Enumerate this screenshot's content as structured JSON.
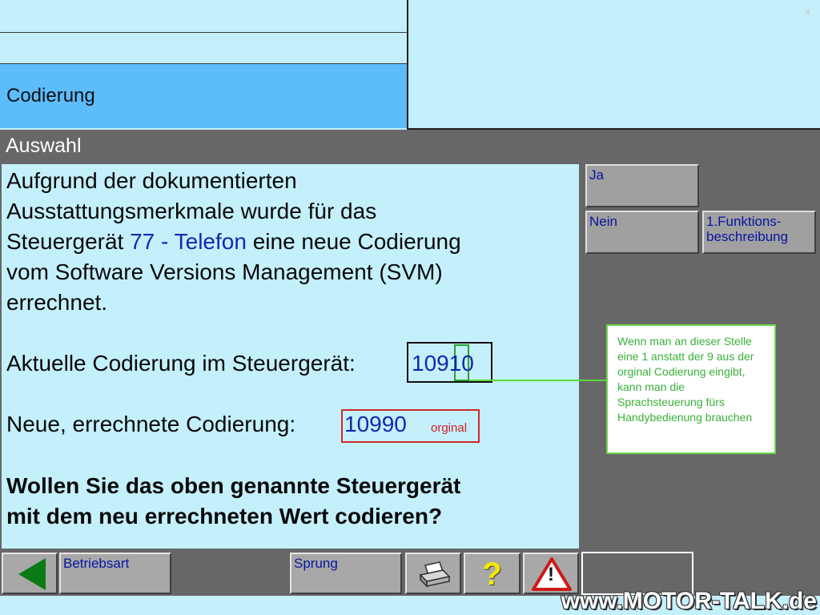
{
  "header": {
    "selected_item": "Codierung",
    "close_glyph": "x"
  },
  "section_title": "Auswahl",
  "message": {
    "line1": "Aufgrund der dokumentierten",
    "line2": "Ausstattungsmerkmale wurde für das",
    "line3_pre": "Steuergerät ",
    "line3_device": "77 - Telefon",
    "line3_post": " eine neue Codierung",
    "line4": "vom Software Versions Management (SVM)",
    "line5": "errechnet.",
    "current_label": "Aktuelle Codierung im Steuergerät:",
    "current_value": "10910",
    "new_label": "Neue, errechnete Codierung:",
    "new_value": "10990",
    "original_note": "orginal",
    "question_line1": "Wollen Sie das oben genannte Steuergerät",
    "question_line2": "mit dem neu errechneten Wert codieren?"
  },
  "side_buttons": {
    "yes": "Ja",
    "no": "Nein",
    "function_desc_line1": "1.Funktions-",
    "function_desc_line2": "beschreibung"
  },
  "note": "Wenn man an dieser Stelle eine 1 anstatt der 9 aus der orginal Codierung eingibt, kann man die Sprachsteuerung fürs Handybedienung brauchen",
  "bottom": {
    "mode_label": "Betriebsart",
    "jump_label": "Sprung",
    "help_glyph": "?",
    "warning_glyph": "!"
  },
  "watermark": "www.MOTOR-TALK.de",
  "colors": {
    "panel_bg": "#c4f0fc",
    "selected_bg": "#5cbcfc",
    "work_gray": "#676767",
    "button_text": "#0814a0",
    "highlight_green": "#2aa32a",
    "highlight_red": "#d02828"
  }
}
